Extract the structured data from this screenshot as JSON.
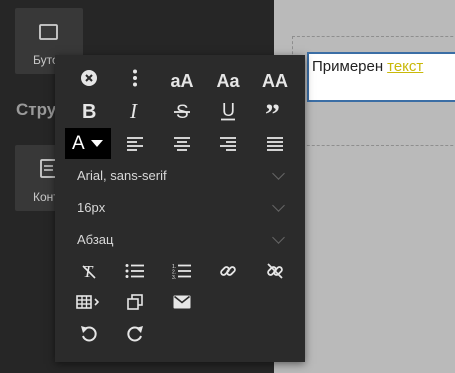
{
  "sidebar": {
    "tile_button_label": "Бутон",
    "heading": "Структура",
    "tile_content_label": "Контейнер"
  },
  "canvas": {
    "text_plain": "Примерен",
    "text_link": "текст"
  },
  "toolbar": {
    "row1": [
      {
        "icon": "close-circle-icon"
      },
      {
        "icon": "more-vertical-icon"
      },
      {
        "text": "aA"
      },
      {
        "text": "Aa"
      },
      {
        "text": "AA"
      }
    ],
    "row2": [
      "bold-icon",
      "italic-icon",
      "strikethrough-icon",
      "underline-icon",
      "quote-icon"
    ],
    "color_letter": "A",
    "row3": [
      "align-left-icon",
      "align-center-icon",
      "align-right-icon",
      "align-justify-icon"
    ],
    "font_family": "Arial, sans-serif",
    "font_size": "16px",
    "block_format": "Абзац",
    "row4": [
      "clear-format-icon",
      "bullet-list-icon",
      "numbered-list-icon",
      "link-icon",
      "unlink-icon"
    ],
    "row5": [
      "table-icon",
      "copy-icon",
      "email-icon"
    ],
    "row6": [
      "undo-icon",
      "redo-icon"
    ]
  }
}
